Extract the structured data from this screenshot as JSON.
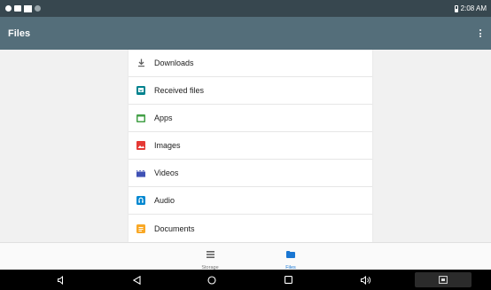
{
  "status_bar": {
    "time": "2:08 AM",
    "left_icons": [
      "notification-dot-icon",
      "notification-square-icon",
      "notification-white-icon",
      "settings-dot-icon"
    ],
    "battery_icon": "battery-icon"
  },
  "app_bar": {
    "title": "Files",
    "overflow_icon": "more-vert-icon"
  },
  "colors": {
    "status_bar": "#37474f",
    "app_bar": "#546e7a",
    "background": "#f1f1f1",
    "accent": "#1976d2",
    "downloads": "#616161",
    "received": "#00838f",
    "apps": "#43a047",
    "images": "#e53935",
    "videos": "#3f51b5",
    "audio": "#0288d1",
    "documents": "#f9a825"
  },
  "list": {
    "items": [
      {
        "label": "Downloads",
        "icon": "download-icon"
      },
      {
        "label": "Received files",
        "icon": "received-files-icon"
      },
      {
        "label": "Apps",
        "icon": "apps-icon"
      },
      {
        "label": "Images",
        "icon": "image-icon"
      },
      {
        "label": "Videos",
        "icon": "video-icon"
      },
      {
        "label": "Audio",
        "icon": "audio-icon"
      },
      {
        "label": "Documents",
        "icon": "document-icon"
      }
    ]
  },
  "bottom_nav": {
    "tabs": [
      {
        "label": "Storage",
        "icon": "storage-icon",
        "selected": false
      },
      {
        "label": "Files",
        "icon": "folder-icon",
        "selected": true
      }
    ]
  },
  "system_nav": {
    "buttons": [
      "volume-down-icon",
      "back-icon",
      "home-icon",
      "recents-icon",
      "volume-up-icon",
      "screenshot-icon"
    ]
  }
}
